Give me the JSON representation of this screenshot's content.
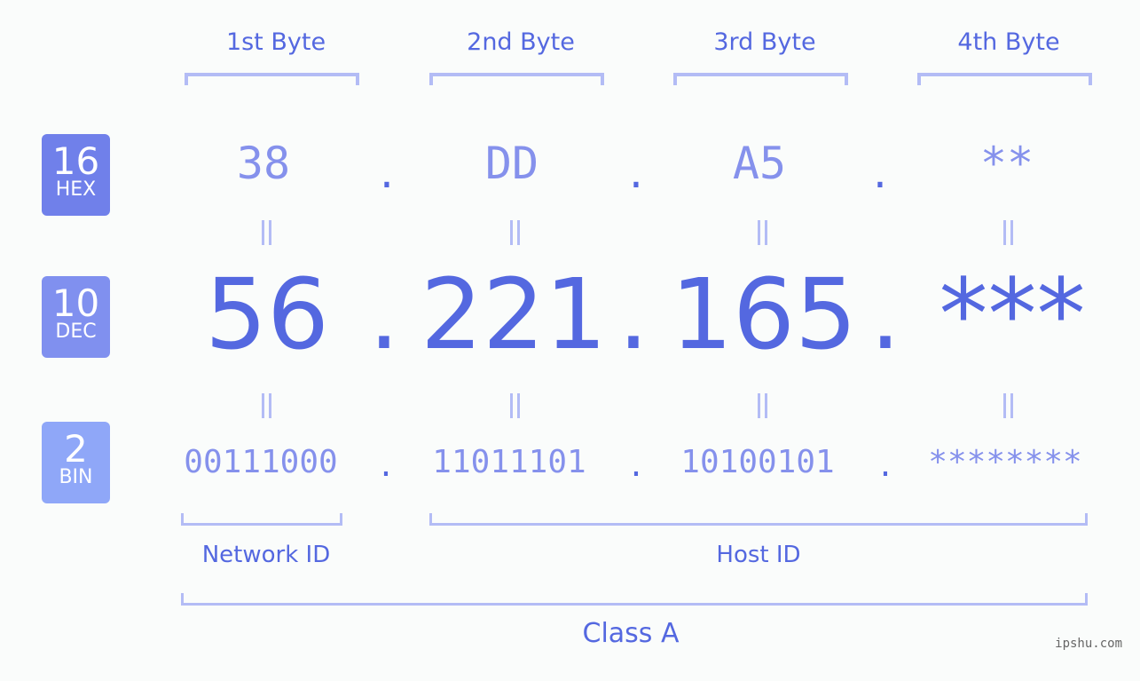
{
  "byte_headers": [
    "1st Byte",
    "2nd Byte",
    "3rd Byte",
    "4th Byte"
  ],
  "badges": {
    "hex": {
      "num": "16",
      "label": "HEX",
      "color": "#7080ea"
    },
    "dec": {
      "num": "10",
      "label": "DEC",
      "color": "#8090ef"
    },
    "bin": {
      "num": "2",
      "label": "BIN",
      "color": "#8fa7f8"
    }
  },
  "hex_values": [
    "38",
    "DD",
    "A5",
    "**"
  ],
  "dec_values": [
    "56",
    "221",
    "165",
    "***"
  ],
  "bin_values": [
    "00111000",
    "11011101",
    "10100101",
    "********"
  ],
  "separator": ".",
  "groups": {
    "network_id": "Network ID",
    "host_id": "Host ID",
    "class": "Class A"
  },
  "watermark": "ipshu.com"
}
